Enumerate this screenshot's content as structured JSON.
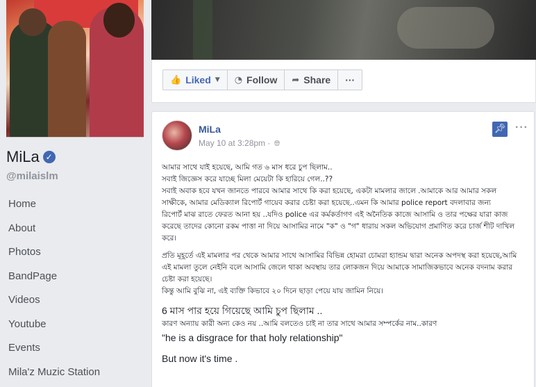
{
  "page": {
    "name": "MiLa",
    "handle": "@milaislm"
  },
  "nav": [
    "Home",
    "About",
    "Photos",
    "BandPage",
    "Videos",
    "Youtube",
    "Events",
    "Mila'z Muzic Station"
  ],
  "actions": {
    "liked": "Liked",
    "follow": "Follow",
    "share": "Share",
    "more": "···"
  },
  "post": {
    "author": "MiLa",
    "timestamp": "May 10 at 3:28pm",
    "menu": "···",
    "lines": [
      "আমার সাথে যাই হয়েছে, আমি গত ৬ মাস ধরে চুপ ছিলাম..",
      "সবাই জিজ্ঞেস করে যাচ্ছে মিলা মেয়েটা কি হারিয়ে গেল..??",
      "সবাই অবাক হবে যখন জানতে পারবে আমার সাথে কি করা হয়েছে, একটা মামলার জালে .আমাকে আর আমার সকল",
      "সাক্ষীকে, আমার মেডিক্যাল রিপোর্ট গায়েব করার চেষ্টা করা হয়েছে..এমন কি আমার police report বদলাবার জন্য",
      "রিপোর্ট মাঝ রাতে ফেরত আনা হয় ..যদিও police এর কর্মকর্তাগণ এই অনৈতিক কাজে আসামি ও তার পক্ষের যারা কাজ",
      "করেছে তাদের কোনো রকম পাত্তা না দিয়ে আসামির নামে \"ক\" ও \"গ\" ধারায় সকল অভিযোগ প্রমাণিত করে চার্জ শীট দাখিল",
      "করে।"
    ],
    "lines2": [
      "প্রতি মূহূর্তে এই মামলার পর থেকে আমার সাথে আসামির বিভিন্ন হোমরা চোমরা হ্যান্ডম দ্বারা অনেক অপদস্থ করা হয়েছে,আমি",
      "এই মামলা তুলে নেইনি বলে আসামি জেলে থাকা অবস্থায় তার লোকজন দিয়ে আমাকে সামাজিকভাবে অনেক বদনাম করার",
      "চেষ্টা করা হয়েছে।",
      "কিন্তু আমি বুঝি না, এই ব্যক্তি কিভাবে ২০ দিনে ছাড়া পেয়ে যায় জামিন নিয়ে।"
    ],
    "line_six_months": "6 মাস পার হয়ে গিয়েছে আমি চুপ ছিলাম ..",
    "line_reason": "কারণ অন্যায় কারী অন্য কেও নয় ..আমি বলতেও চাই না তার সাথে আমার সম্পর্কের নাম..কারণ",
    "quote": "\"he is a disgrace for that holy relationship\"",
    "closing": "But now it's time ."
  },
  "colors": {
    "accent": "#4267b2",
    "link": "#365899",
    "background": "#e9ebee"
  }
}
